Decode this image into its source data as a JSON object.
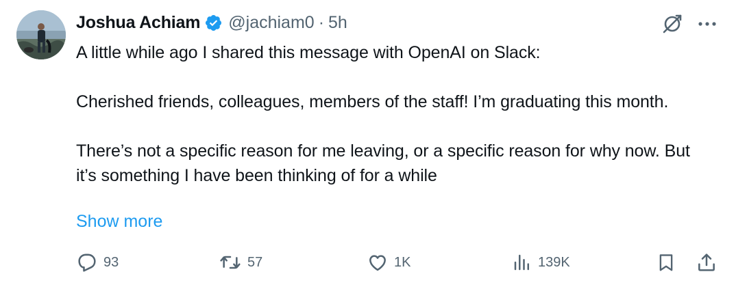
{
  "author": {
    "name": "Joshua Achiam",
    "handle": "@jachiam0",
    "separator": "·",
    "time": "5h",
    "verified": true,
    "verified_color": "#1d9bf0"
  },
  "tweet": {
    "paragraphs": [
      "A little while ago I shared this message with OpenAI on Slack:",
      "Cherished friends, colleagues, members of the staff! I’m graduating this month.",
      "There’s not a specific reason for me leaving, or a specific reason for why now. But it’s something I have been thinking of for a while"
    ],
    "show_more": "Show more"
  },
  "actions": {
    "replies": "93",
    "reposts": "57",
    "likes": "1K",
    "views": "139K"
  },
  "icons": {
    "grok": "grok-icon",
    "more": "more-dots-icon",
    "reply": "reply-icon",
    "repost": "repost-icon",
    "like": "heart-icon",
    "views": "analytics-icon",
    "bookmark": "bookmark-icon",
    "share": "share-icon"
  },
  "colors": {
    "text": "#0f1419",
    "secondary": "#536471",
    "link": "#1d9bf0"
  }
}
